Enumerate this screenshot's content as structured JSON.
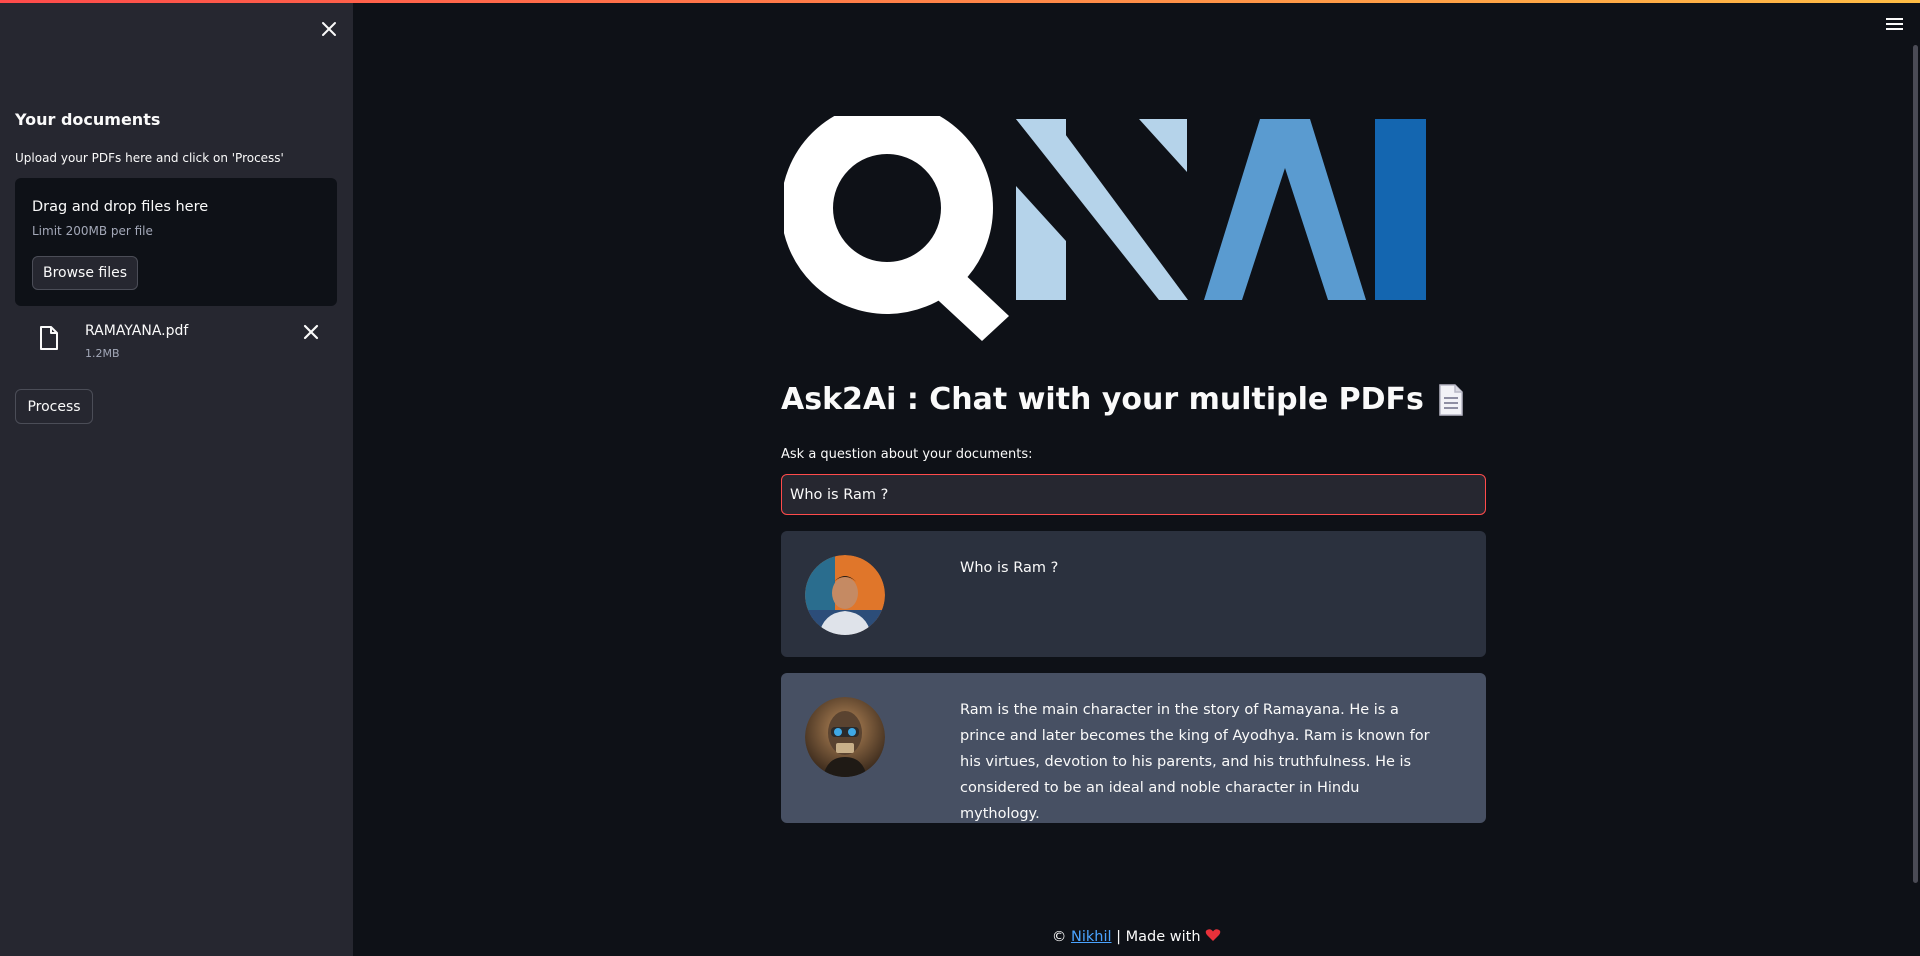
{
  "sidebar": {
    "title": "Your documents",
    "instruction": "Upload your PDFs here and click on 'Process'",
    "dropzone": {
      "title": "Drag and drop files here",
      "limit": "Limit 200MB per file",
      "browse_label": "Browse files"
    },
    "files": [
      {
        "name": "RAMAYANA.pdf",
        "size": "1.2MB"
      }
    ],
    "process_label": "Process"
  },
  "main": {
    "logo_text": "QNAI",
    "title": "Ask2Ai : Chat with your multiple PDFs",
    "question_label": "Ask a question about your documents:",
    "question_value": "Who is Ram ?",
    "messages": [
      {
        "role": "user",
        "text": "Who is Ram ?"
      },
      {
        "role": "bot",
        "text": "Ram is the main character in the story of Ramayana. He is a prince and later becomes the king of Ayodhya. Ram is known for his virtues, devotion to his parents, and his truthfulness. He is considered to be an ideal and noble character in Hindu mythology."
      }
    ]
  },
  "footer": {
    "prefix": "© ",
    "author_link": "Nikhil",
    "suffix": " | Made with "
  },
  "icons": {
    "sidebar_close": "close-icon",
    "file": "file-icon",
    "file_remove": "close-icon",
    "menu": "hamburger-menu-icon",
    "title_emoji": "page-document-icon",
    "footer_heart": "heart-icon"
  },
  "colors": {
    "accent": "#ff4b4b",
    "background": "#0e1117",
    "sidebar": "#262730",
    "user_message": "#2b313e",
    "bot_message": "#475063",
    "link": "#4aa3ff"
  }
}
